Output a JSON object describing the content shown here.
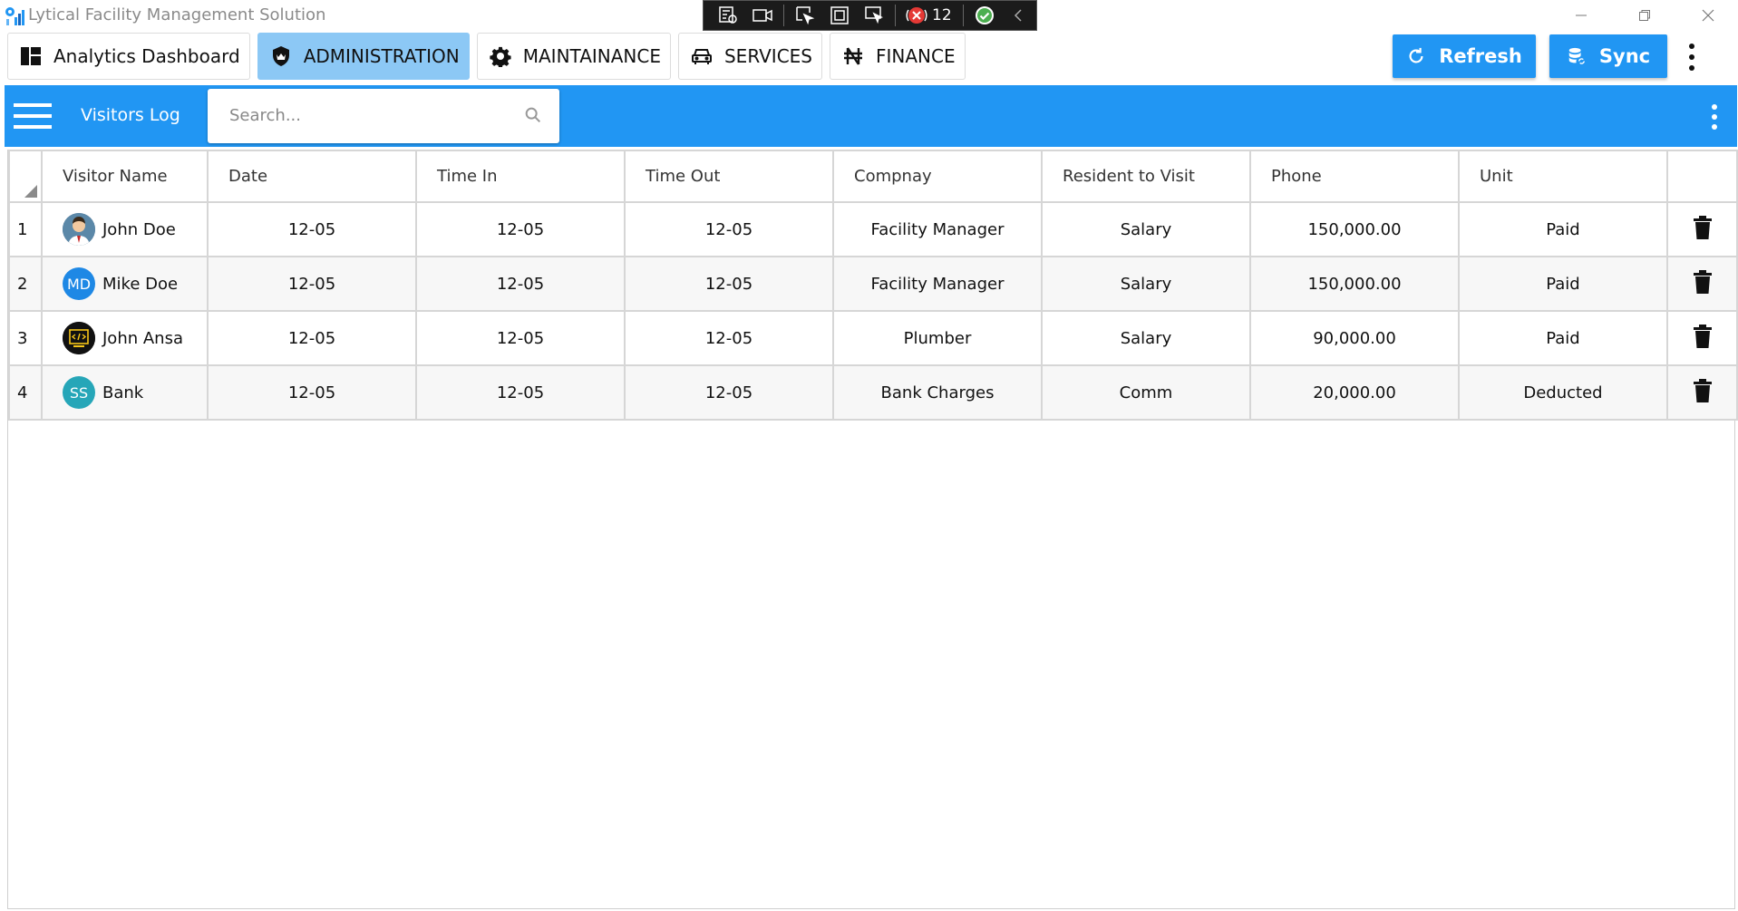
{
  "app": {
    "title": "Lytical Facility Management Solution"
  },
  "debug_toolbar": {
    "count": "12"
  },
  "tabs": [
    {
      "label": "Analytics Dashboard",
      "icon": "dashboard-icon",
      "active": false
    },
    {
      "label": "ADMINISTRATION",
      "icon": "shield-icon",
      "active": true
    },
    {
      "label": "MAINTAINANCE",
      "icon": "gear-icon",
      "active": false
    },
    {
      "label": "SERVICES",
      "icon": "car-icon",
      "active": false
    },
    {
      "label": "FINANCE",
      "icon": "naira-icon",
      "active": false
    }
  ],
  "actions": {
    "refresh_label": "Refresh",
    "sync_label": "Sync"
  },
  "appbar": {
    "title": "Visitors Log",
    "search_placeholder": "Search..."
  },
  "grid": {
    "columns": [
      "Visitor Name",
      "Date",
      "Time In",
      "Time Out",
      "Compnay",
      "Resident to Visit",
      "Phone",
      "Unit"
    ],
    "rows": [
      {
        "num": "1",
        "avatar_type": "photo",
        "avatar_text": "",
        "name": "John Doe",
        "date": "12-05",
        "time_in": "12-05",
        "time_out": "12-05",
        "company": "Facility Manager",
        "resident": "Salary",
        "phone": "150,000.00",
        "unit": "Paid"
      },
      {
        "num": "2",
        "avatar_type": "initials",
        "avatar_text": "MD",
        "name": "Mike Doe",
        "date": "12-05",
        "time_in": "12-05",
        "time_out": "12-05",
        "company": "Facility Manager",
        "resident": "Salary",
        "phone": "150,000.00",
        "unit": "Paid"
      },
      {
        "num": "3",
        "avatar_type": "code",
        "avatar_text": "",
        "name": "John Ansa",
        "date": "12-05",
        "time_in": "12-05",
        "time_out": "12-05",
        "company": "Plumber",
        "resident": "Salary",
        "phone": "90,000.00",
        "unit": "Paid"
      },
      {
        "num": "4",
        "avatar_type": "initials",
        "avatar_text": "SS",
        "name": "Bank",
        "date": "12-05",
        "time_in": "12-05",
        "time_out": "12-05",
        "company": "Bank Charges",
        "resident": "Comm",
        "phone": "20,000.00",
        "unit": "Deducted"
      }
    ]
  },
  "colors": {
    "primary": "#2196f3",
    "active_tab": "#8cc8f5",
    "avatar_md": "#1e88e5",
    "avatar_ss": "#26a6b8"
  }
}
